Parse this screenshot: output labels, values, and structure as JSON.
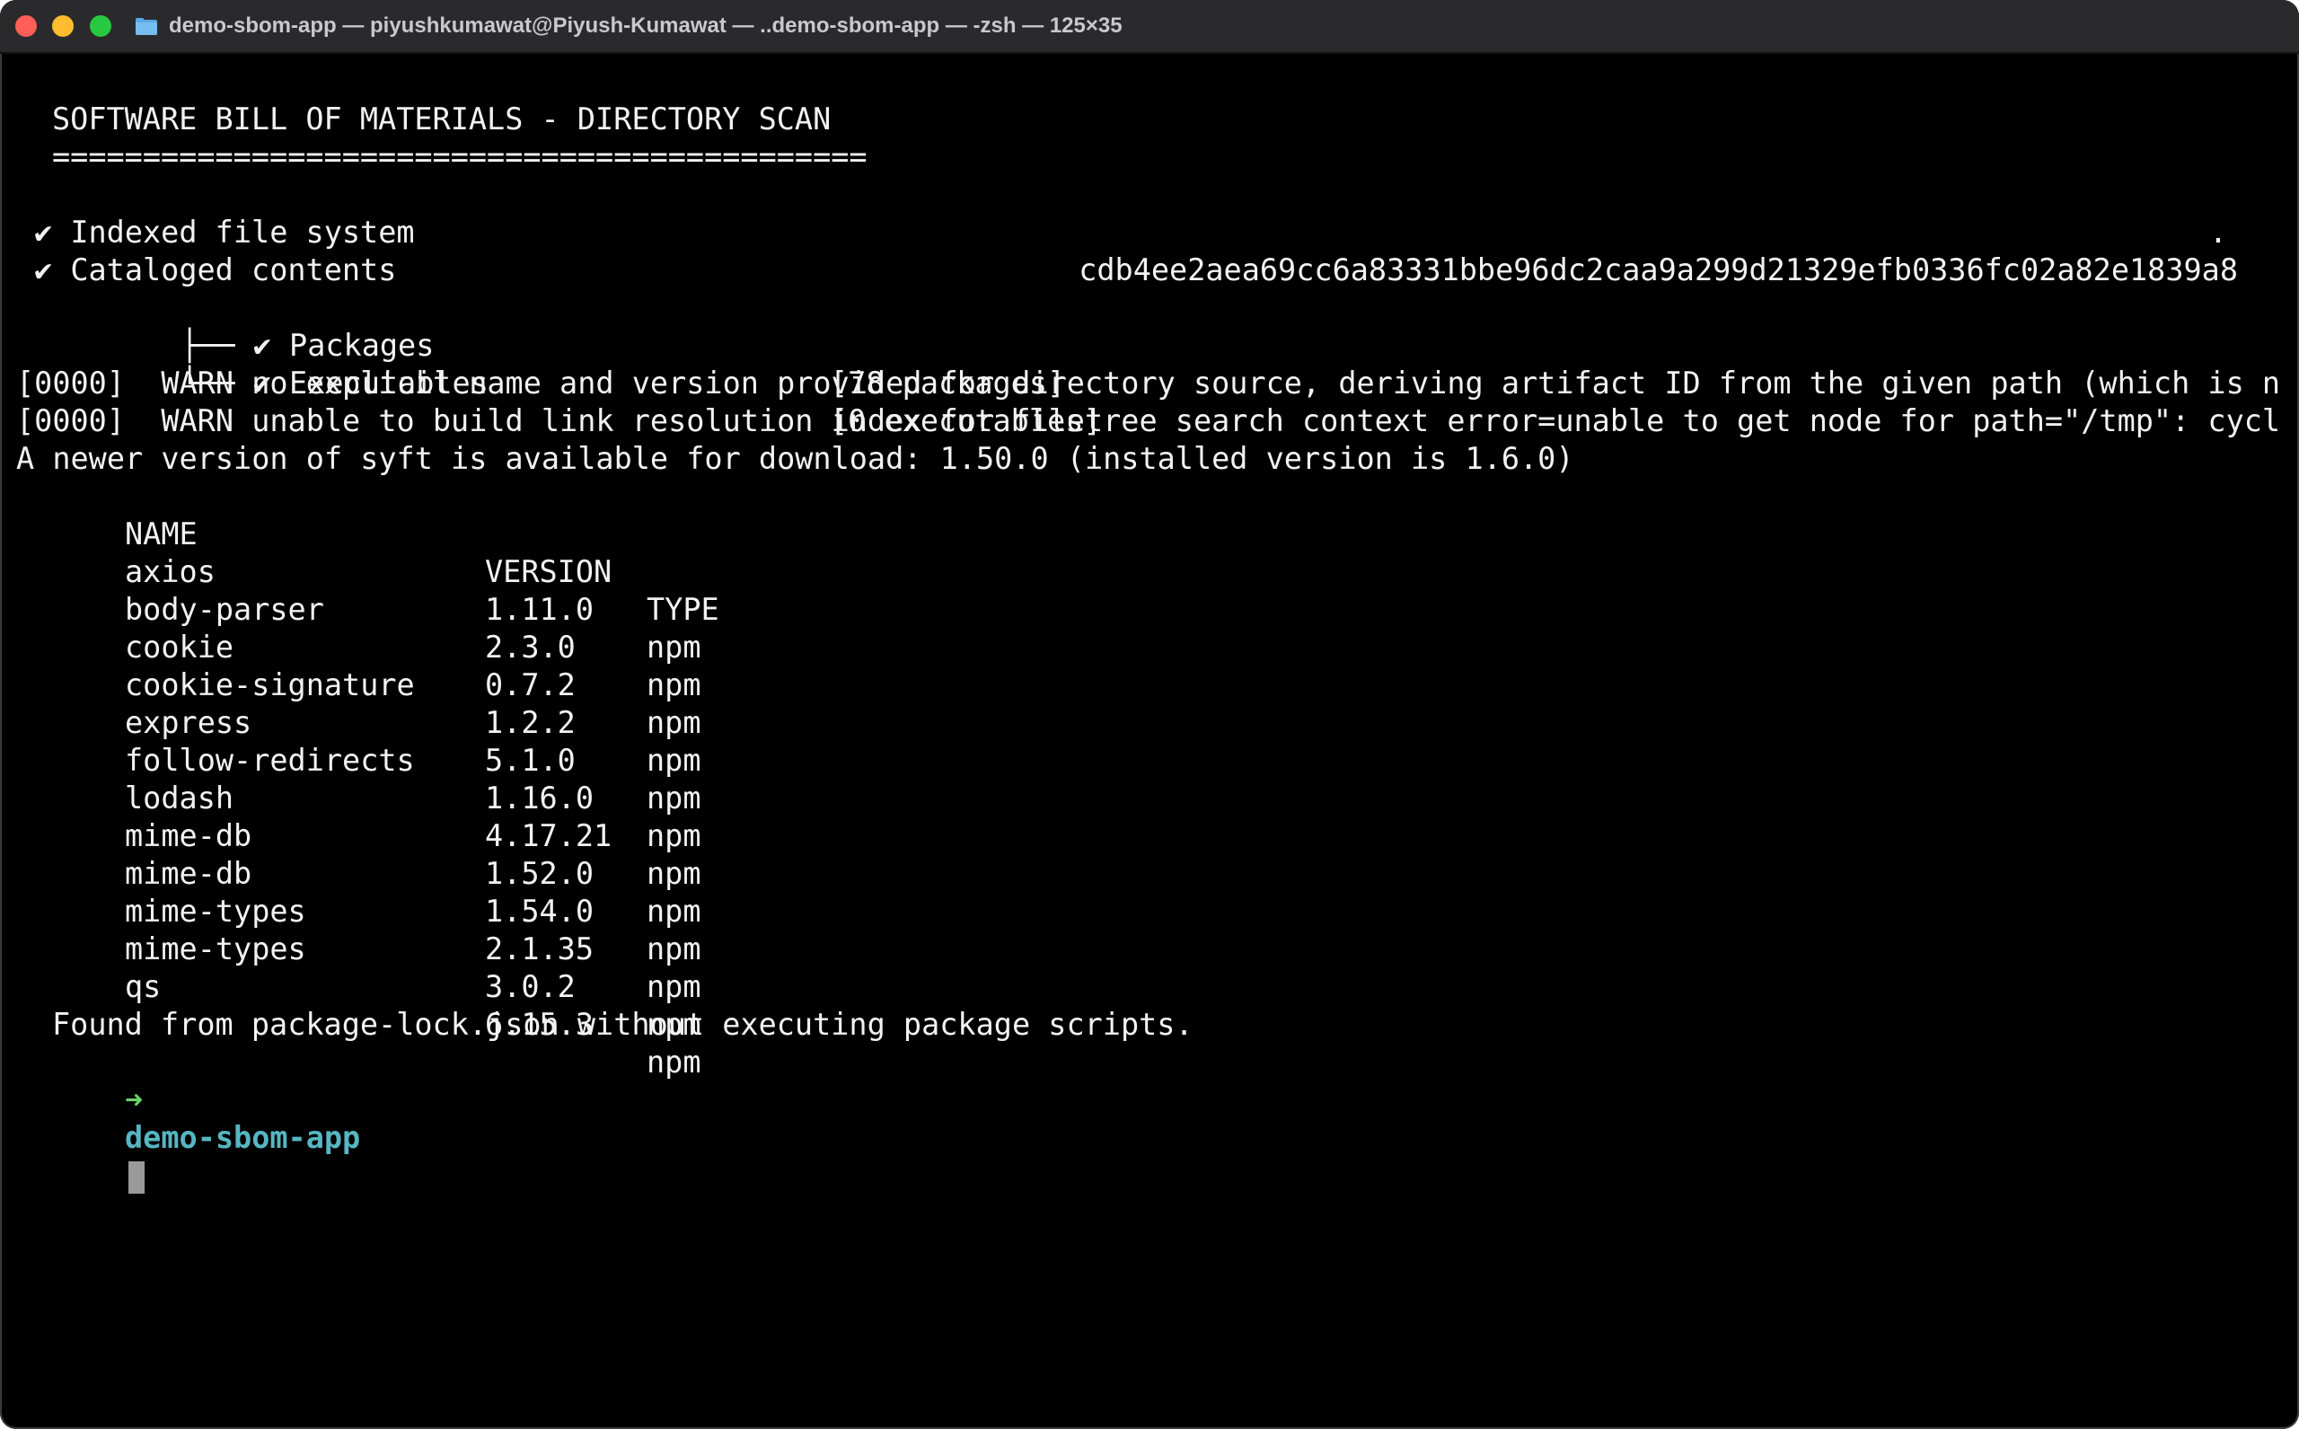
{
  "window": {
    "title": "demo-sbom-app — piyushkumawat@Piyush-Kumawat — ..demo-sbom-app — -zsh — 125×35"
  },
  "colors": {
    "background": "#000000",
    "text": "#f2f2f2",
    "prompt_arrow": "#6ad26a",
    "prompt_dir": "#56b6c2"
  },
  "output": {
    "heading": "SOFTWARE BILL OF MATERIALS - DIRECTORY SCAN",
    "underline": "=============================================",
    "indexed": "✔ Indexed file system",
    "indexed_suffix": ".",
    "cataloged": "✔ Cataloged contents",
    "digest": "cdb4ee2aea69cc6a83331bbe96dc2caa9a299d21329efb0336fc02a82e1839a8",
    "packages_label": "├── ✔ Packages",
    "packages_count": "[78 packages]",
    "executables_label": "└── ✔ Executables",
    "executables_count": "[0 executables]",
    "warn1": "[0000]  WARN no explicit name and version provided for directory source, deriving artifact ID from the given path (which is n",
    "warn2": "[0000]  WARN unable to build link resolution index for filetree search context error=unable to get node for path=\"/tmp\": cycl",
    "update_notice": "A newer version of syft is available for download: 1.50.0 (installed version is 1.6.0)",
    "footer": "Found from package-lock.json without executing package scripts."
  },
  "table": {
    "headers": [
      "NAME",
      "VERSION",
      "TYPE"
    ],
    "rows": [
      [
        "axios",
        "1.11.0",
        "npm"
      ],
      [
        "body-parser",
        "2.3.0",
        "npm"
      ],
      [
        "cookie",
        "0.7.2",
        "npm"
      ],
      [
        "cookie-signature",
        "1.2.2",
        "npm"
      ],
      [
        "express",
        "5.1.0",
        "npm"
      ],
      [
        "follow-redirects",
        "1.16.0",
        "npm"
      ],
      [
        "lodash",
        "4.17.21",
        "npm"
      ],
      [
        "mime-db",
        "1.52.0",
        "npm"
      ],
      [
        "mime-db",
        "1.54.0",
        "npm"
      ],
      [
        "mime-types",
        "2.1.35",
        "npm"
      ],
      [
        "mime-types",
        "3.0.2",
        "npm"
      ],
      [
        "qs",
        "6.15.3",
        "npm"
      ]
    ]
  },
  "prompt": {
    "arrow": "➜",
    "directory": "demo-sbom-app"
  }
}
